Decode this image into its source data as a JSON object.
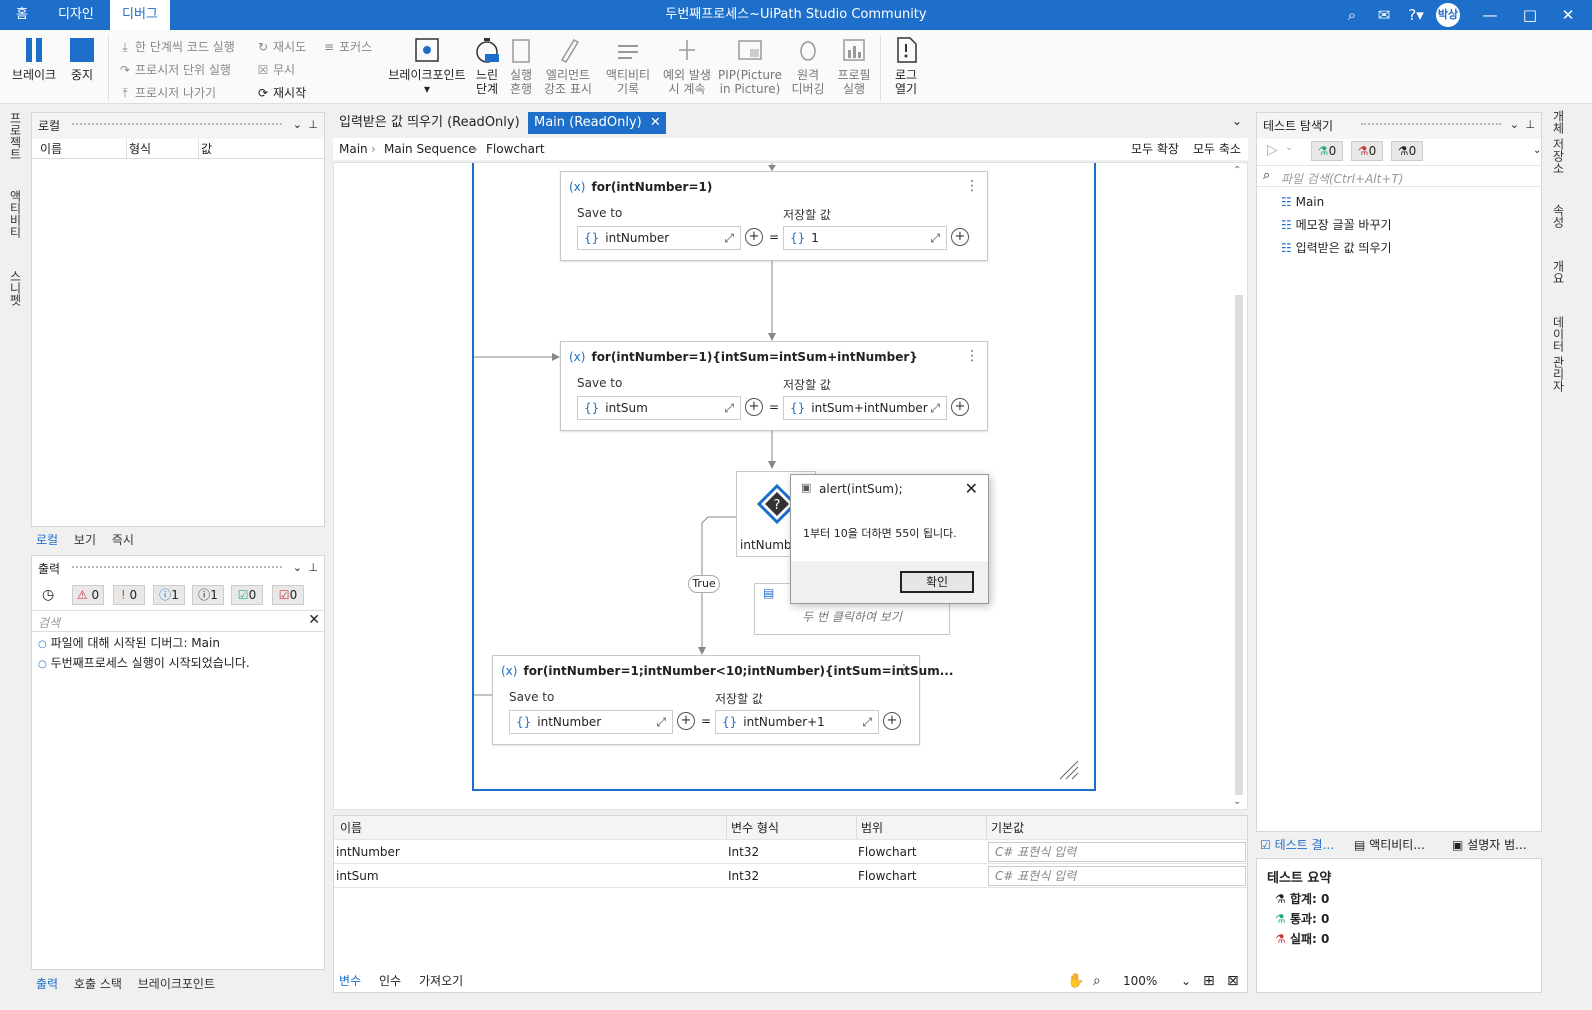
{
  "titlebar": {
    "tabs": [
      {
        "label": "홈"
      },
      {
        "label": "디자인"
      },
      {
        "label": "디버그"
      }
    ],
    "title": "두번째프로세스~UiPath Studio Community",
    "user_initials": "박상"
  },
  "ribbon": {
    "break_label": "브레이크",
    "stop_label": "중지",
    "step_into": "한 단계씩 코드 실행",
    "step_over": "프로시저 단위 실행",
    "step_out": "프로시저 나가기",
    "retry": "재시도",
    "ignore": "무시",
    "restart": "재시작",
    "focus": "포커스",
    "breakpoints": "브레이크포인트",
    "slow_step": "느린\n단계",
    "execution_trail": "실행\n흔행",
    "highlight_elements": "엘리먼트\n강조 표시",
    "log_activities": "액티비티\n기록",
    "continue_on_exception": "예외 발생\n시 계속",
    "pip": "PIP(Picture\nin Picture)",
    "remote_debugging": "원격\n디버깅",
    "profile_execution": "프로필\n실행",
    "open_logs": "로그\n열기"
  },
  "left_strip": [
    "프로젝트",
    "액티비티",
    "스니펫"
  ],
  "locals_panel": {
    "title": "로컬",
    "columns": [
      "이름",
      "형식",
      "값"
    ],
    "tabs": [
      "로컬",
      "보기",
      "즉시"
    ]
  },
  "output_panel": {
    "title": "출력",
    "counters": [
      "0",
      "0",
      "1",
      "1",
      "0",
      "0"
    ],
    "search_placeholder": "검색",
    "lines": [
      "파일에 대해 시작된 디버그: Main",
      "두번째프로세스 실행이 시작되었습니다."
    ],
    "tabs": [
      "출력",
      "호출 스택",
      "브레이크포인트"
    ]
  },
  "designer": {
    "tabs": [
      "입력받은 값 띄우기 (ReadOnly)",
      "Main (ReadOnly)"
    ],
    "breadcrumb": [
      "Main",
      "Main Sequence",
      "Flowchart"
    ],
    "expand_all": "모두 확장",
    "collapse_all": "모두 축소",
    "assign1": {
      "title": "for(intNumber=1)",
      "save_to": "Save to",
      "value_label": "저장할 값",
      "to": "intNumber",
      "value": "1"
    },
    "assign2": {
      "title": "for(intNumber=1){intSum=intSum+intNumber}",
      "save_to": "Save to",
      "value_label": "저장할 값",
      "to": "intSum",
      "value": "intSum+intNumber"
    },
    "decision_label": "intNumbe",
    "true_label": "True",
    "message_hint": "두 번 클릭하여 보기",
    "assign3": {
      "title": "for(intNumber=1;intNumber<10;intNumber){intSum=intSum...",
      "save_to": "Save to",
      "value_label": "저장할 값",
      "to": "intNumber",
      "value": "intNumber+1"
    }
  },
  "dialog": {
    "title": "alert(intSum);",
    "message": "1부터 10을 더하면 55이 됩니다.",
    "ok": "확인"
  },
  "variables": {
    "columns": [
      "이름",
      "변수 형식",
      "범위",
      "기본값"
    ],
    "rows": [
      {
        "name": "intNumber",
        "type": "Int32",
        "scope": "Flowchart",
        "default": "C# 표현식 입력"
      },
      {
        "name": "intSum",
        "type": "Int32",
        "scope": "Flowchart",
        "default": "C# 표현식 입력"
      }
    ],
    "bottom_tabs": [
      "변수",
      "인수",
      "가져오기"
    ],
    "zoom": "100%"
  },
  "test_explorer": {
    "title": "테스트 탐색기",
    "counters": [
      "0",
      "0",
      "0"
    ],
    "search_placeholder": "파일 검색(Ctrl+Alt+T)",
    "items": [
      "Main",
      "메모장 글꼴 바꾸기",
      "입력받은 값 띄우기"
    ],
    "bottom_tabs": [
      "테스트 결...",
      "액티비티...",
      "설명자 범..."
    ],
    "summary_title": "테스트 요약",
    "total": "합계: 0",
    "passed": "통과: 0",
    "failed": "실패: 0"
  },
  "right_strip": [
    "개체 저장소",
    "속성",
    "개요",
    "데이터 관리자"
  ]
}
